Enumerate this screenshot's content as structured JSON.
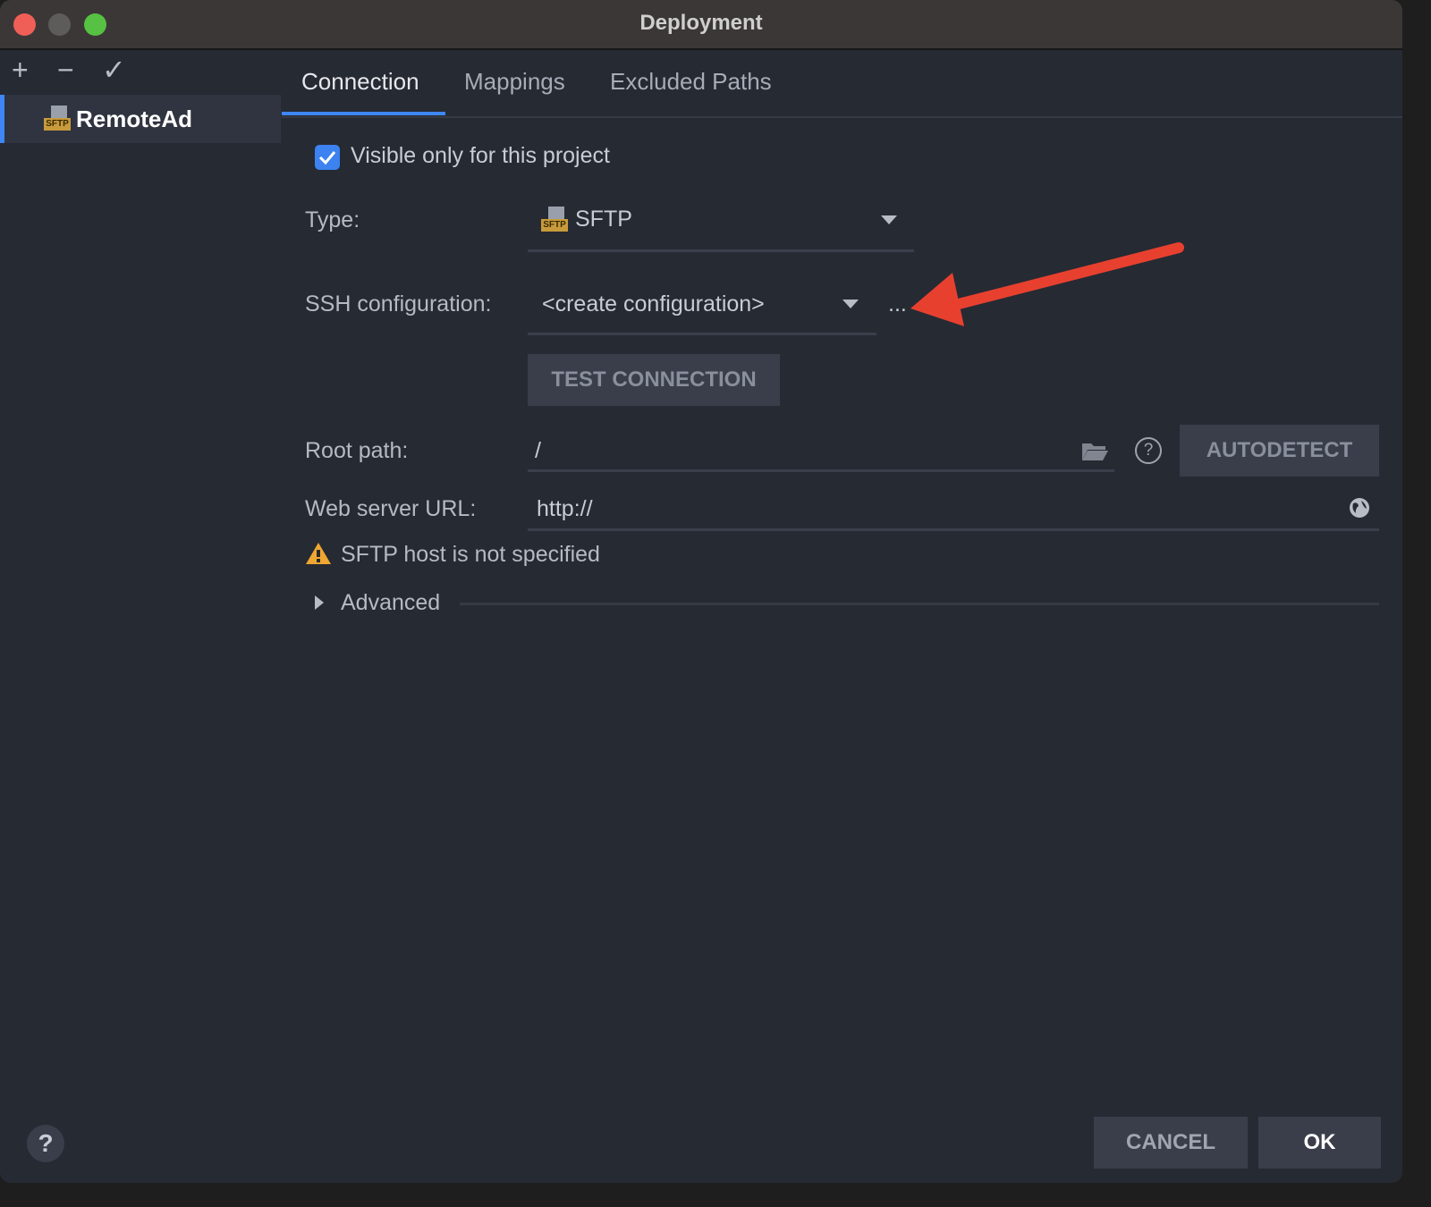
{
  "window": {
    "title": "Deployment"
  },
  "sidebar": {
    "toolbar": {
      "add": "+",
      "remove": "−",
      "apply": "✓"
    },
    "items": [
      {
        "label": "RemoteAd",
        "icon": "sftp-icon",
        "tag": "SFTP"
      }
    ]
  },
  "tabs": [
    {
      "label": "Connection"
    },
    {
      "label": "Mappings"
    },
    {
      "label": "Excluded Paths"
    }
  ],
  "form": {
    "visible_only": {
      "label": "Visible only for this project",
      "checked": true
    },
    "type": {
      "label": "Type:",
      "value": "SFTP",
      "tag": "SFTP"
    },
    "ssh": {
      "label": "SSH configuration:",
      "value": "<create configuration>",
      "more": "..."
    },
    "test_connection": "TEST CONNECTION",
    "root_path": {
      "label": "Root path:",
      "value": "/",
      "help": "?"
    },
    "autodetect": "AUTODETECT",
    "web_url": {
      "label": "Web server URL:",
      "value": "http://"
    },
    "warning": "SFTP host is not specified",
    "advanced": "Advanced"
  },
  "footer": {
    "help": "?",
    "cancel": "CANCEL",
    "ok": "OK"
  },
  "colors": {
    "accent": "#3f87f5",
    "warning": "#f0a732",
    "annotation_arrow": "#e8402f"
  }
}
